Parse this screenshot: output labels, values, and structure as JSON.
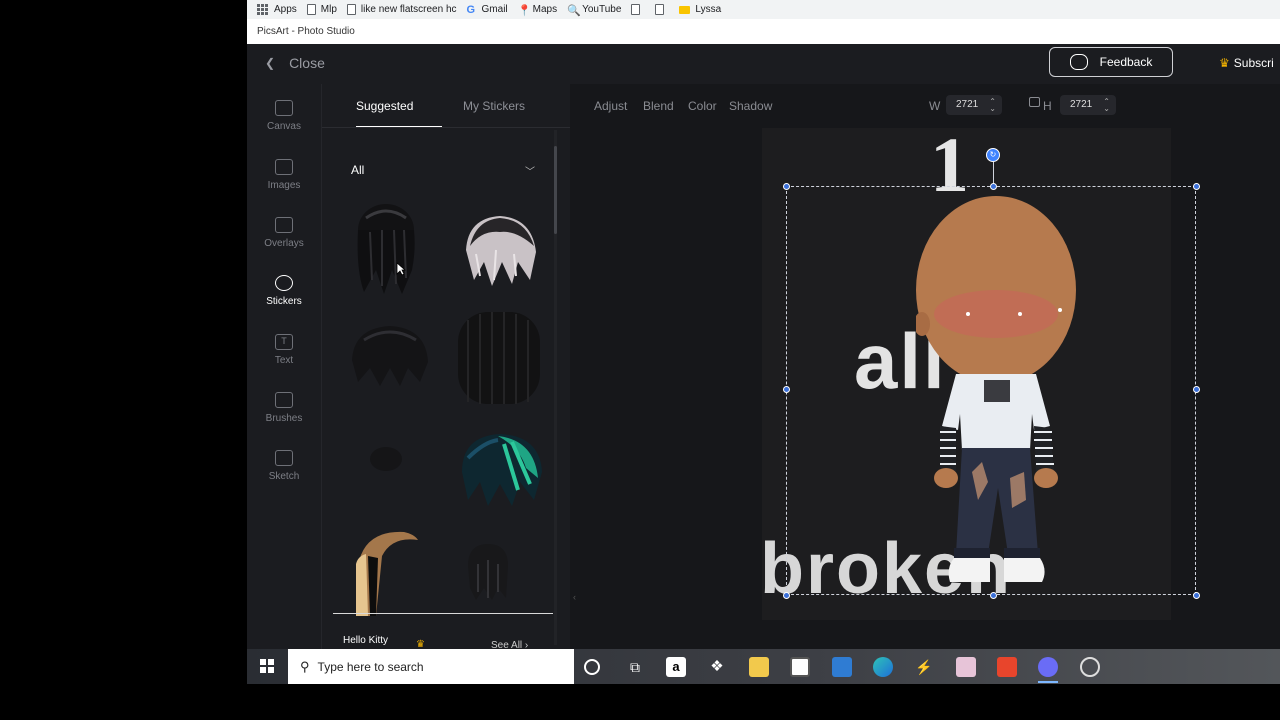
{
  "bookmarks": [
    {
      "label": "Apps",
      "icon": "apps-grid-icon"
    },
    {
      "label": "Mlp",
      "icon": "page-icon"
    },
    {
      "label": "like new flatscreen hc",
      "icon": "page-icon"
    },
    {
      "label": "Gmail",
      "icon": "google-icon"
    },
    {
      "label": "Maps",
      "icon": "maps-pin-icon"
    },
    {
      "label": "YouTube",
      "icon": "search-icon"
    },
    {
      "label": "",
      "icon": "page-icon"
    },
    {
      "label": "",
      "icon": "page-icon"
    },
    {
      "label": "Lyssa",
      "icon": "folder-icon"
    }
  ],
  "window_title": "PicsArt - Photo Studio",
  "header": {
    "close_label": "Close",
    "feedback_label": "Feedback",
    "subscribe_label": "Subscri"
  },
  "rail": [
    {
      "label": "Canvas",
      "icon": "canvas-icon"
    },
    {
      "label": "Images",
      "icon": "images-icon"
    },
    {
      "label": "Overlays",
      "icon": "overlays-icon"
    },
    {
      "label": "Stickers",
      "icon": "stickers-icon",
      "active": true
    },
    {
      "label": "Text",
      "icon": "text-icon"
    },
    {
      "label": "Brushes",
      "icon": "brushes-icon"
    },
    {
      "label": "Sketch",
      "icon": "sketch-icon"
    }
  ],
  "panel": {
    "tabs": [
      "Suggested",
      "My Stickers"
    ],
    "category": "All",
    "section_title": "Hello Kitty",
    "see_all": "See All"
  },
  "toolbar": {
    "tools": [
      "Adjust",
      "Blend",
      "Color",
      "Shadow"
    ],
    "width_label": "W",
    "width_value": "2721",
    "height_label": "H",
    "height_value": "2721"
  },
  "canvas": {
    "text_top": "1",
    "text_mid": "all",
    "text_bottom": "broken"
  },
  "taskbar": {
    "search_placeholder": "Type here to search"
  },
  "colors": {
    "accent": "#3f83ff",
    "panel_bg": "#1b1c20",
    "canvas_bg": "#16171a",
    "crown": "#f5b400"
  }
}
